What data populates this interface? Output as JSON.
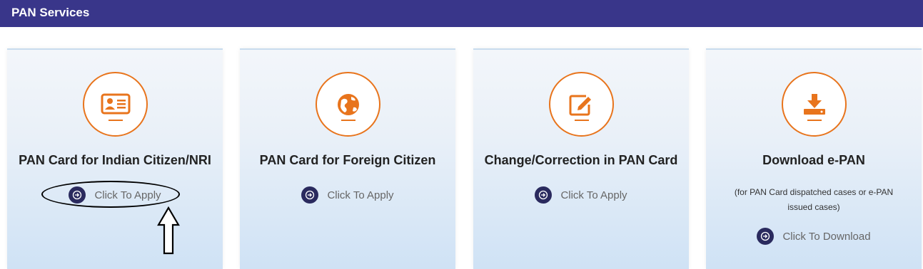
{
  "header": {
    "title": "PAN Services"
  },
  "colors": {
    "header_bg": "#39368a",
    "accent_orange": "#e8741c",
    "link_circle": "#2a2a5e"
  },
  "cards": [
    {
      "title": "PAN Card for Indian Citizen/NRI",
      "icon": "id-card-icon",
      "link": "Click To Apply"
    },
    {
      "title": "PAN Card for Foreign Citizen",
      "icon": "globe-icon",
      "link": "Click To Apply"
    },
    {
      "title": "Change/Correction in PAN Card",
      "icon": "edit-icon",
      "link": "Click To Apply"
    },
    {
      "title": "Download e-PAN",
      "icon": "download-icon",
      "note": "(for PAN Card dispatched cases or e-PAN issued cases)",
      "link": "Click To Download"
    }
  ]
}
